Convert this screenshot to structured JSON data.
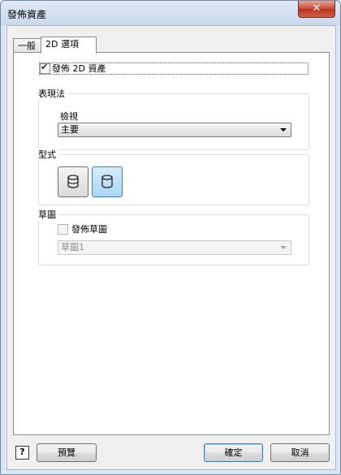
{
  "window": {
    "title": "發佈資產",
    "close_symbol": "✕"
  },
  "tabs": [
    {
      "label": "一般"
    },
    {
      "label": "2D 選項"
    }
  ],
  "publish_2d": {
    "label": "發佈 2D 資產",
    "checked": true
  },
  "representation": {
    "group_label": "表現法",
    "view_label": "檢視",
    "view_value": "主要"
  },
  "style": {
    "group_label": "型式",
    "buttons": [
      {
        "icon": "cylinder-shaded-icon",
        "active": false
      },
      {
        "icon": "cylinder-outline-icon",
        "active": true
      }
    ]
  },
  "sketch": {
    "group_label": "草圖",
    "publish_label": "發佈草圖",
    "publish_checked": false,
    "sketch_value": "草圖1"
  },
  "footer": {
    "help_symbol": "?",
    "preview_label": "預覽",
    "ok_label": "確定",
    "cancel_label": "取消"
  }
}
